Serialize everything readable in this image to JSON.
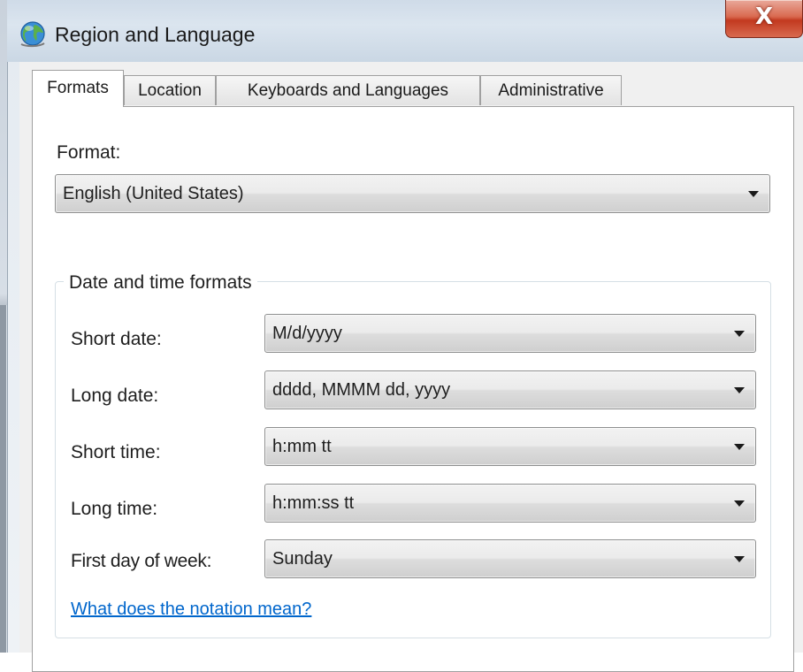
{
  "window": {
    "title": "Region and Language",
    "icon": "globe-icon",
    "close_glyph": "X"
  },
  "tabs": [
    {
      "label": "Formats",
      "active": true
    },
    {
      "label": "Location",
      "active": false
    },
    {
      "label": "Keyboards and Languages",
      "active": false
    },
    {
      "label": "Administrative",
      "active": false
    }
  ],
  "formats": {
    "format_label": "Format:",
    "format_value": "English (United States)",
    "group_title": "Date and time formats",
    "rows": [
      {
        "label": "Short date:",
        "value": "M/d/yyyy"
      },
      {
        "label": "Long date:",
        "value": "dddd, MMMM dd, yyyy"
      },
      {
        "label": "Short time:",
        "value": "h:mm tt"
      },
      {
        "label": "Long time:",
        "value": "h:mm:ss tt"
      },
      {
        "label": "First day of week:",
        "value": "Sunday"
      }
    ],
    "notation_link": "What does the notation mean?"
  },
  "colors": {
    "link": "#0066cc",
    "close_button": "#c2391f",
    "title_bar": "#cfdbe8"
  }
}
